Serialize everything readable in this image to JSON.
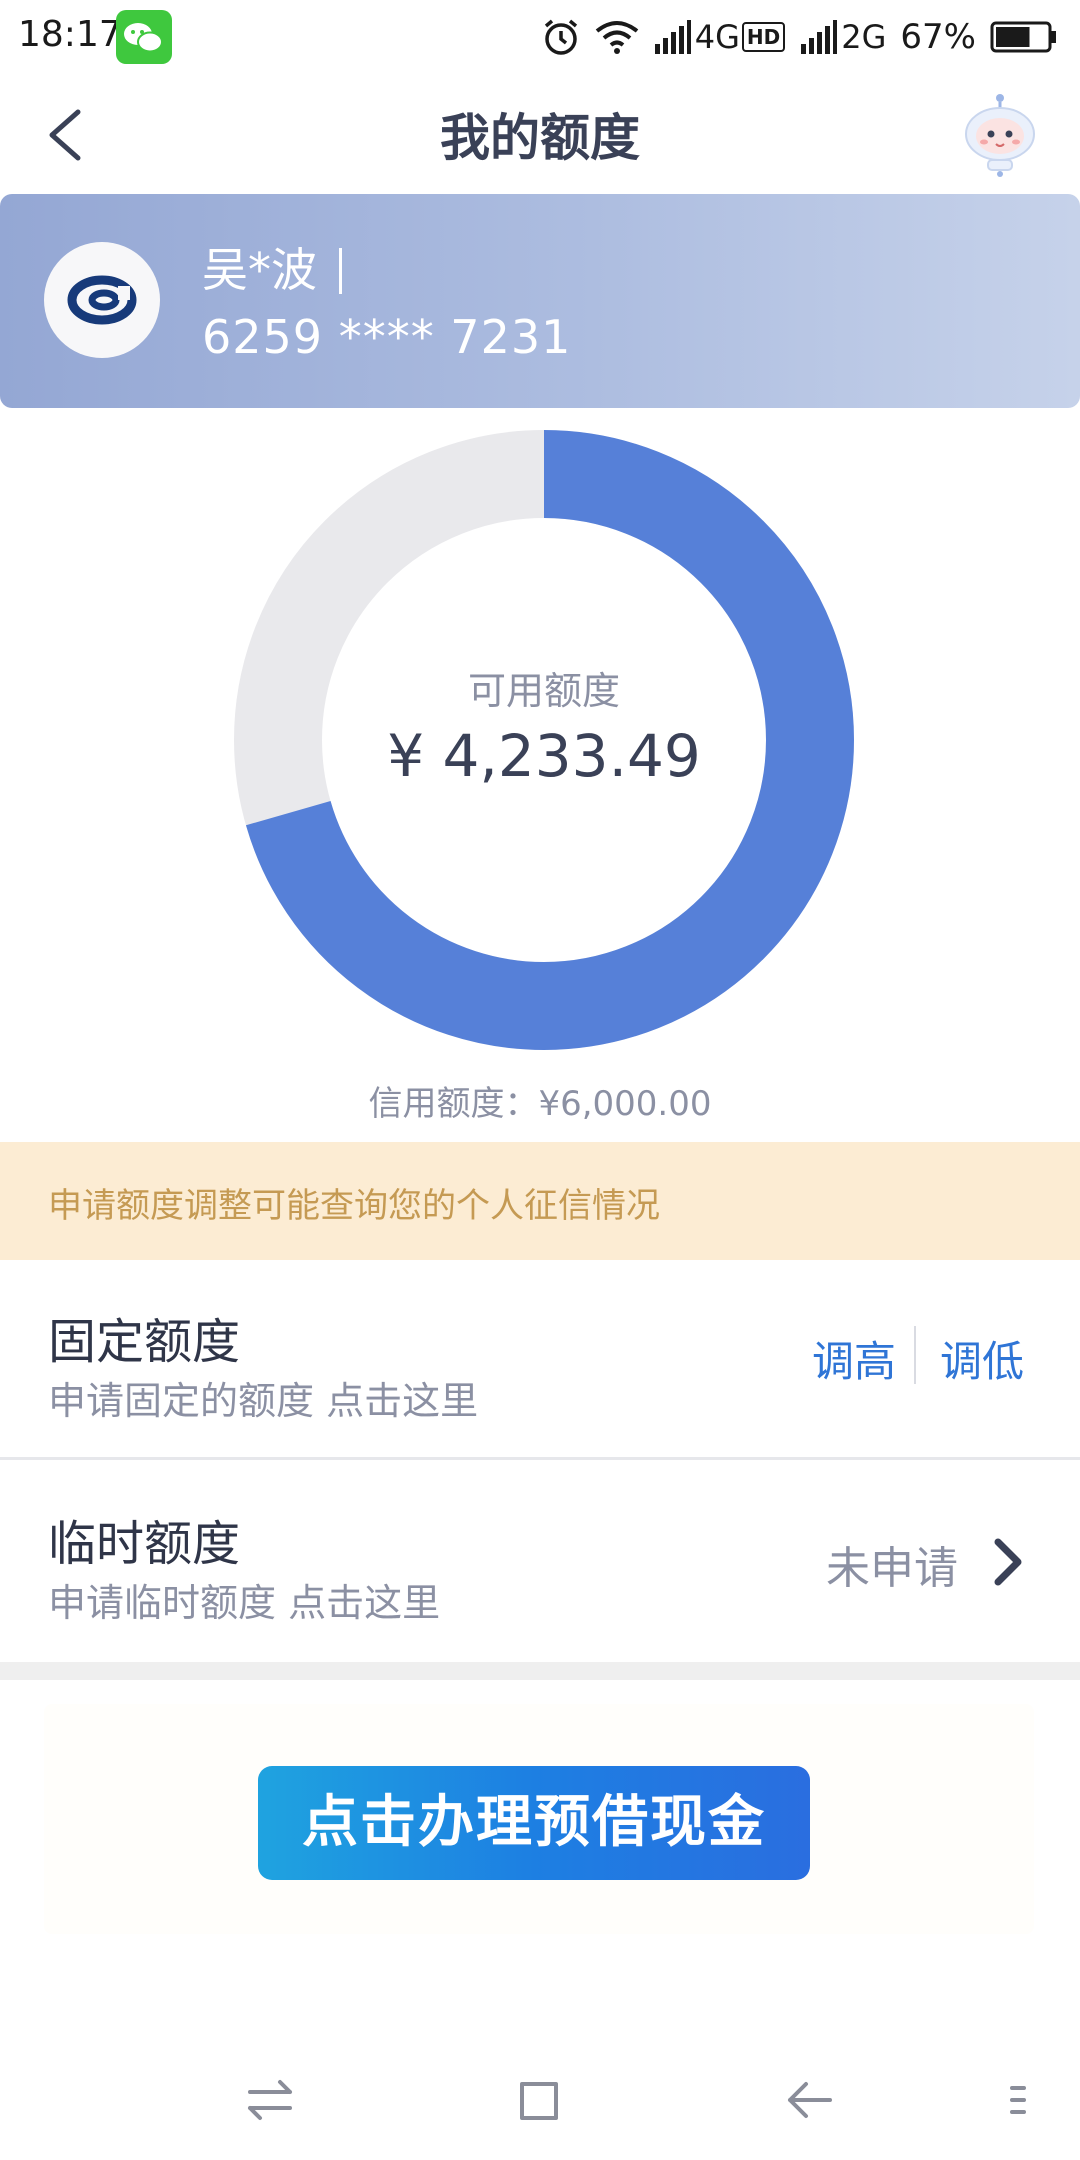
{
  "status_bar": {
    "time": "18:17",
    "net1": "4G",
    "hd": "HD",
    "net2": "2G",
    "battery": "67%",
    "battery_level": 0.67
  },
  "header": {
    "title": "我的额度"
  },
  "card": {
    "holder_name": "吴*波",
    "card_number": "6259 **** 7231"
  },
  "limits": {
    "available_label": "可用额度",
    "available_value": "¥ 4,233.49",
    "credit_line_text": "信用额度：¥6,000.00",
    "available_amount": 4233.49,
    "credit_amount": 6000.0
  },
  "notice": {
    "text": "申请额度调整可能查询您的个人征信情况"
  },
  "fixed_limit": {
    "title": "固定额度",
    "subtitle": "申请固定的额度 点击这里",
    "raise_label": "调高",
    "lower_label": "调低"
  },
  "temp_limit": {
    "title": "临时额度",
    "subtitle": "申请临时额度 点击这里",
    "status": "未申请"
  },
  "promo": {
    "button_label": "点击办理预借现金"
  },
  "colors": {
    "donut_used": "#e9e9ec",
    "donut_available": "#5680d8",
    "accent": "#2f75d6"
  }
}
